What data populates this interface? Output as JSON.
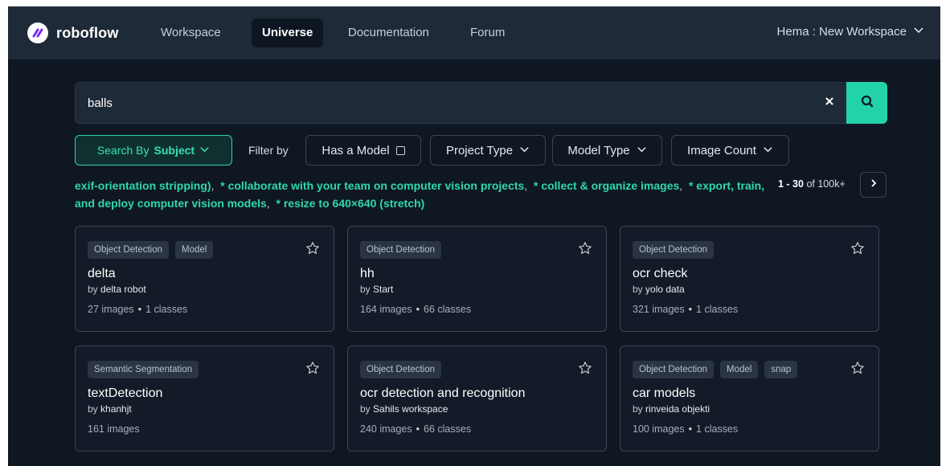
{
  "header": {
    "brand": "roboflow",
    "tabs": [
      {
        "label": "Workspace",
        "active": false
      },
      {
        "label": "Universe",
        "active": true
      },
      {
        "label": "Documentation",
        "active": false
      },
      {
        "label": "Forum",
        "active": false
      }
    ],
    "workspace_label": "Hema : New Workspace"
  },
  "search": {
    "value": "balls"
  },
  "filters": {
    "search_by_prefix": "Search By",
    "search_by_value": "Subject",
    "filter_by_label": "Filter by",
    "has_model_label": "Has a Model",
    "project_type_label": "Project Type",
    "model_type_label": "Model Type",
    "image_count_label": "Image Count"
  },
  "tags": [
    "exif-orientation stripping)",
    "* collaborate with your team on computer vision projects",
    "* collect & organize images",
    "* export, train, and deploy computer vision models",
    "* resize to 640×640 (stretch)"
  ],
  "pagination": {
    "range": "1 - 30",
    "total": "of 100k+"
  },
  "cards": [
    {
      "badges": [
        "Object Detection",
        "Model"
      ],
      "title": "delta",
      "by": "by",
      "owner": "delta robot",
      "images": "27 images",
      "classes": "1 classes"
    },
    {
      "badges": [
        "Object Detection"
      ],
      "title": "hh",
      "by": "by",
      "owner": "Start",
      "images": "164 images",
      "classes": "66 classes"
    },
    {
      "badges": [
        "Object Detection"
      ],
      "title": "ocr check",
      "by": "by",
      "owner": "yolo data",
      "images": "321 images",
      "classes": "1 classes"
    },
    {
      "badges": [
        "Semantic Segmentation"
      ],
      "title": "textDetection",
      "by": "by",
      "owner": "khanhjt",
      "images": "161 images",
      "classes": ""
    },
    {
      "badges": [
        "Object Detection"
      ],
      "title": "ocr detection and recognition",
      "by": "by",
      "owner": "Sahils workspace",
      "images": "240 images",
      "classes": "66 classes"
    },
    {
      "badges": [
        "Object Detection",
        "Model",
        "snap"
      ],
      "title": "car models",
      "by": "by",
      "owner": "rinveida objekti",
      "images": "100 images",
      "classes": "1 classes"
    }
  ],
  "colors": {
    "background": "#0f1722",
    "header": "#1f2a38",
    "accent": "#22d3a9",
    "card_border": "#3a4556"
  },
  "icons": {
    "logo": "roboflow-logo-icon",
    "workspace_chevron": "chevron-down-icon",
    "clear": "close-icon",
    "search": "search-icon",
    "next": "chevron-right-icon",
    "favorite": "star-icon"
  }
}
